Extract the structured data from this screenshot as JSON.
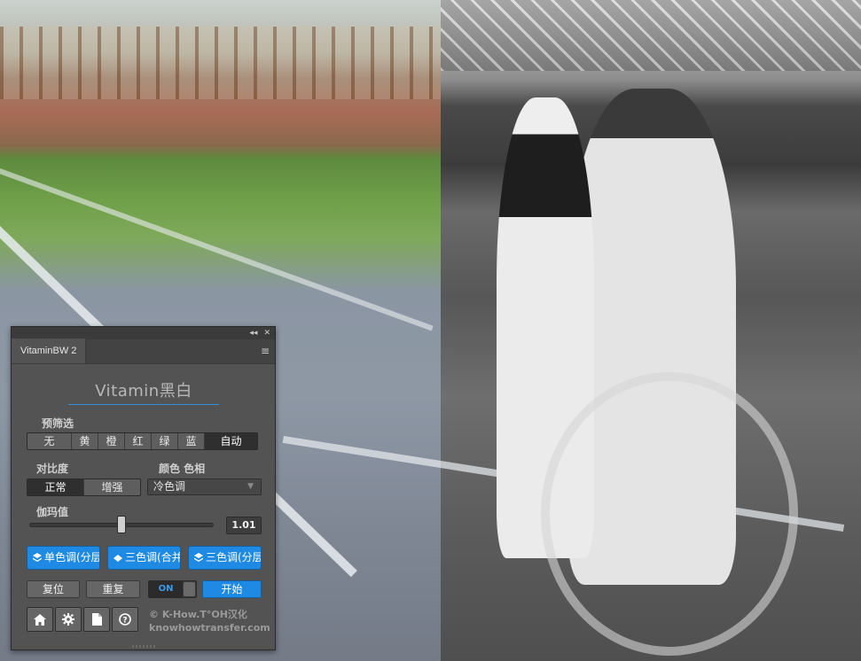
{
  "panel": {
    "controls": {
      "collapse": "◂◂",
      "close": "✕"
    },
    "tab": "VitaminBW 2",
    "title": "Vitamin黑白",
    "presets": {
      "label": "预筛选",
      "options": [
        "无",
        "黄",
        "橙",
        "红",
        "绿",
        "蓝",
        "自动"
      ],
      "selected": "自动"
    },
    "contrast": {
      "label": "对比度",
      "options": [
        "正常",
        "增强"
      ],
      "selected": "正常"
    },
    "hue": {
      "label": "颜色 色相",
      "value": "冷色调"
    },
    "gamma": {
      "label": "伽玛值",
      "value": "1.01",
      "slider_fraction": 0.5
    },
    "modes": [
      {
        "label": "单色调(分层",
        "icon": "layers-icon"
      },
      {
        "label": "三色调(合并",
        "icon": "merge-icon"
      },
      {
        "label": "三色调(分层",
        "icon": "layers-icon"
      }
    ],
    "reset_label": "复位",
    "repeat_label": "重复",
    "toggle_label": "ON",
    "start_label": "开始",
    "toolbar_icons": [
      "home-icon",
      "gear-icon",
      "document-icon",
      "help-icon"
    ],
    "credits": {
      "line1": "©  K-How.T°OH汉化",
      "line2": "knowhowtransfer.com"
    }
  },
  "colors": {
    "accent": "#1f8ae3",
    "panel_bg": "#535353"
  }
}
